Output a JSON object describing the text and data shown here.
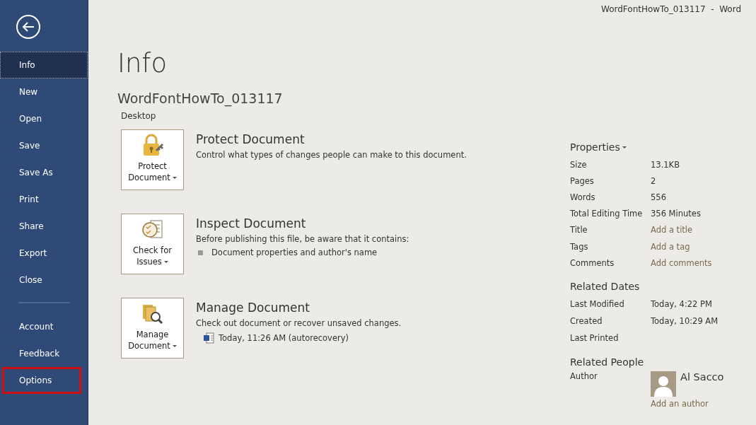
{
  "window": {
    "title": "WordFontHowTo_013117  -  Word"
  },
  "sidebar": {
    "items": [
      {
        "label": "Info",
        "selected": true,
        "outlined": false
      },
      {
        "label": "New",
        "selected": false,
        "outlined": false
      },
      {
        "label": "Open",
        "selected": false,
        "outlined": false
      },
      {
        "label": "Save",
        "selected": false,
        "outlined": false
      },
      {
        "label": "Save As",
        "selected": false,
        "outlined": false
      },
      {
        "label": "Print",
        "selected": false,
        "outlined": false
      },
      {
        "label": "Share",
        "selected": false,
        "outlined": false
      },
      {
        "label": "Export",
        "selected": false,
        "outlined": false
      },
      {
        "label": "Close",
        "selected": false,
        "outlined": false
      }
    ],
    "bottom_items": [
      {
        "label": "Account",
        "selected": false,
        "outlined": false
      },
      {
        "label": "Feedback",
        "selected": false,
        "outlined": false
      },
      {
        "label": "Options",
        "selected": false,
        "outlined": true
      }
    ]
  },
  "page": {
    "heading": "Info",
    "document_name": "WordFontHowTo_013117",
    "location": "Desktop"
  },
  "sections": [
    {
      "kind": "protect",
      "button_lines": [
        "Protect",
        "Document"
      ],
      "title": "Protect Document",
      "description": "Control what types of changes people can make to this document."
    },
    {
      "kind": "inspect",
      "button_lines": [
        "Check for",
        "Issues"
      ],
      "title": "Inspect Document",
      "description": "Before publishing this file, be aware that it contains:",
      "bullets": [
        "Document properties and author's name"
      ]
    },
    {
      "kind": "manage",
      "button_lines": [
        "Manage",
        "Document"
      ],
      "title": "Manage Document",
      "description": "Check out document or recover unsaved changes.",
      "versions": [
        "Today, 11:26 AM (autorecovery)"
      ]
    }
  ],
  "properties": {
    "heading": "Properties",
    "rows": [
      {
        "label": "Size",
        "value": "13.1KB",
        "kind": "text"
      },
      {
        "label": "Pages",
        "value": "2",
        "kind": "text"
      },
      {
        "label": "Words",
        "value": "556",
        "kind": "text"
      },
      {
        "label": "Total Editing Time",
        "value": "356 Minutes",
        "kind": "text"
      },
      {
        "label": "Title",
        "value": "Add a title",
        "kind": "link"
      },
      {
        "label": "Tags",
        "value": "Add a tag",
        "kind": "link"
      },
      {
        "label": "Comments",
        "value": "Add comments",
        "kind": "link"
      }
    ]
  },
  "related_dates": {
    "heading": "Related Dates",
    "rows": [
      {
        "label": "Last Modified",
        "value": "Today, 4:22 PM"
      },
      {
        "label": "Created",
        "value": "Today, 10:29 AM"
      },
      {
        "label": "Last Printed"
      }
    ]
  },
  "related_people": {
    "heading": "Related People",
    "label": "Author",
    "author": "Al Sacco",
    "add_link": "Add an author"
  }
}
